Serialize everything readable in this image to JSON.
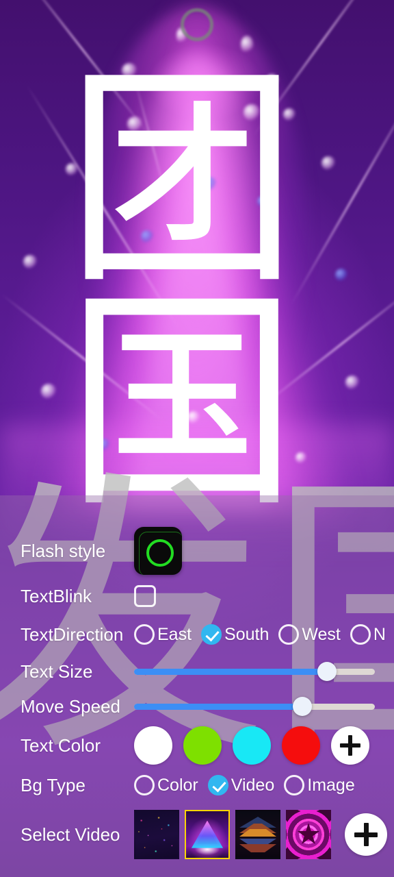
{
  "app": {
    "marquee_text_lines": [
      "团",
      "国"
    ],
    "watermark_text": "发国"
  },
  "status_bar": {
    "punch_hole_icon": "camera-punch-hole"
  },
  "settings": {
    "rows": {
      "flash_style": {
        "label": "Flash style",
        "thumbnail_icon": "green-ring-flash-thumbnail"
      },
      "text_blink": {
        "label": "TextBlink",
        "checked": false
      },
      "text_direction": {
        "label": "TextDirection",
        "options": [
          {
            "label": "East",
            "selected": false
          },
          {
            "label": "South",
            "selected": true
          },
          {
            "label": "West",
            "selected": false
          },
          {
            "label": "N",
            "selected": false
          }
        ]
      },
      "text_size": {
        "label": "Text Size",
        "percent": 80
      },
      "move_speed": {
        "label": "Move Speed",
        "percent": 70
      },
      "text_color": {
        "label": "Text Color",
        "swatches": [
          "#ffffff",
          "#7ee000",
          "#18e8f5",
          "#f50d0d"
        ],
        "add_button_icon": "plus-icon"
      },
      "bg_type": {
        "label": "Bg Type",
        "options": [
          {
            "label": "Color",
            "selected": false
          },
          {
            "label": "Video",
            "selected": true
          },
          {
            "label": "Image",
            "selected": false
          }
        ]
      },
      "select_video": {
        "label": "Select Video",
        "thumbnails": [
          {
            "name": "confetti-bokeh-video",
            "selected": false
          },
          {
            "name": "neon-triangle-video",
            "selected": true
          },
          {
            "name": "chevron-tunnel-video",
            "selected": false
          },
          {
            "name": "magenta-kaleidoscope-video",
            "selected": false
          }
        ],
        "add_button_icon": "plus-icon"
      }
    }
  },
  "colors": {
    "accent_blue": "#31b7f0",
    "slider_fill": "#3c8ef5",
    "slider_track": "#ded8d4",
    "selection_border": "#ffd500",
    "panel_overlay": "rgba(150,110,170,.42)",
    "label_text": "#ffffff"
  }
}
